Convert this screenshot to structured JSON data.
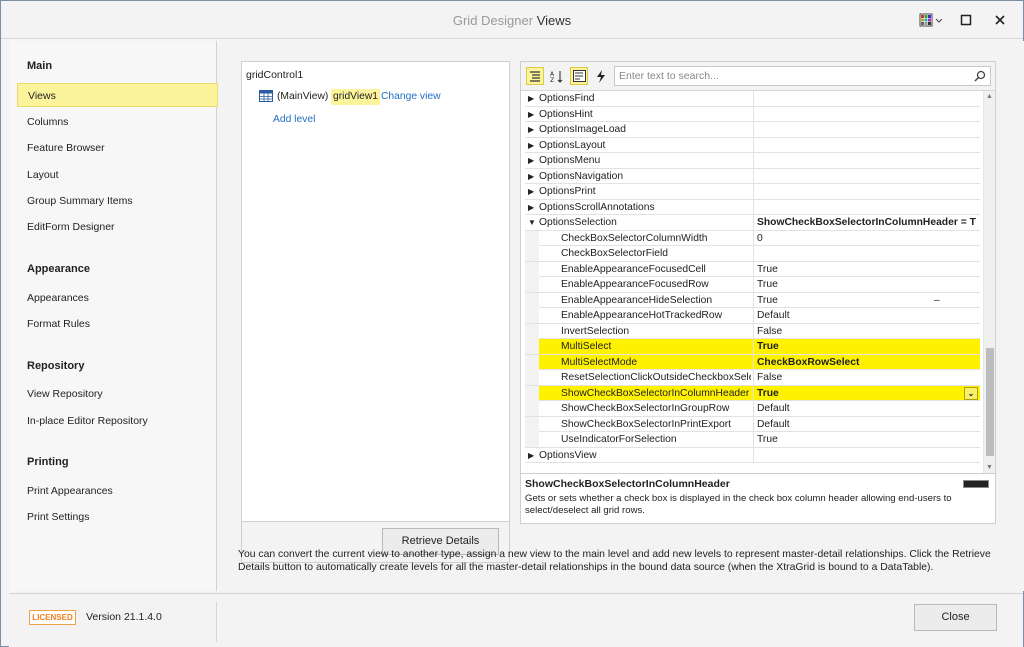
{
  "window": {
    "title_prefix": "Grid Designer",
    "title_main": "Views"
  },
  "sidebar": {
    "groups": [
      {
        "title": "Main",
        "items": [
          {
            "label": "Views",
            "active": true
          },
          {
            "label": "Columns"
          },
          {
            "label": "Feature Browser"
          },
          {
            "label": "Layout"
          },
          {
            "label": "Group Summary Items"
          },
          {
            "label": "EditForm Designer"
          }
        ]
      },
      {
        "title": "Appearance",
        "items": [
          {
            "label": "Appearances"
          },
          {
            "label": "Format Rules"
          }
        ]
      },
      {
        "title": "Repository",
        "items": [
          {
            "label": "View Repository"
          },
          {
            "label": "In-place Editor Repository"
          }
        ]
      },
      {
        "title": "Printing",
        "items": [
          {
            "label": "Print Appearances"
          },
          {
            "label": "Print Settings"
          }
        ]
      }
    ]
  },
  "tree": {
    "root": "gridControl1",
    "main_view_label": "(MainView)",
    "view_name": "gridView1",
    "change_view": "Change view",
    "add_level": "Add level",
    "retrieve_button": "Retrieve Details"
  },
  "properties": {
    "search_placeholder": "Enter text to search...",
    "rows": [
      {
        "name": "OptionsFind",
        "value": "",
        "level": 0,
        "expander": "right"
      },
      {
        "name": "OptionsHint",
        "value": "",
        "level": 0,
        "expander": "right"
      },
      {
        "name": "OptionsImageLoad",
        "value": "",
        "level": 0,
        "expander": "right"
      },
      {
        "name": "OptionsLayout",
        "value": "",
        "level": 0,
        "expander": "right"
      },
      {
        "name": "OptionsMenu",
        "value": "",
        "level": 0,
        "expander": "right"
      },
      {
        "name": "OptionsNavigation",
        "value": "",
        "level": 0,
        "expander": "right"
      },
      {
        "name": "OptionsPrint",
        "value": "",
        "level": 0,
        "expander": "right"
      },
      {
        "name": "OptionsScrollAnnotations",
        "value": "",
        "level": 0,
        "expander": "right"
      },
      {
        "name": "OptionsSelection",
        "value": "ShowCheckBoxSelectorInColumnHeader = T",
        "level": 0,
        "expander": "down",
        "bold_value": true
      },
      {
        "name": "CheckBoxSelectorColumnWidth",
        "value": "0",
        "level": 1
      },
      {
        "name": "CheckBoxSelectorField",
        "value": "",
        "level": 1
      },
      {
        "name": "EnableAppearanceFocusedCell",
        "value": "True",
        "level": 1
      },
      {
        "name": "EnableAppearanceFocusedRow",
        "value": "True",
        "level": 1
      },
      {
        "name": "EnableAppearanceHideSelection",
        "value": "True",
        "level": 1,
        "extra": "–"
      },
      {
        "name": "EnableAppearanceHotTrackedRow",
        "value": "Default",
        "level": 1
      },
      {
        "name": "InvertSelection",
        "value": "False",
        "level": 1
      },
      {
        "name": "MultiSelect",
        "value": "True",
        "level": 1,
        "highlight": true,
        "bold_value": true
      },
      {
        "name": "MultiSelectMode",
        "value": "CheckBoxRowSelect",
        "level": 1,
        "highlight": true,
        "bold_value": true
      },
      {
        "name": "ResetSelectionClickOutsideCheckboxSelect",
        "value": "False",
        "level": 1
      },
      {
        "name": "ShowCheckBoxSelectorInColumnHeader",
        "value": "True",
        "level": 1,
        "highlight": true,
        "bold_value": true,
        "combo": true
      },
      {
        "name": "ShowCheckBoxSelectorInGroupRow",
        "value": "Default",
        "level": 1
      },
      {
        "name": "ShowCheckBoxSelectorInPrintExport",
        "value": "Default",
        "level": 1
      },
      {
        "name": "UseIndicatorForSelection",
        "value": "True",
        "level": 1
      },
      {
        "name": "OptionsView",
        "value": "",
        "level": 0,
        "expander": "right"
      }
    ],
    "description_title": "ShowCheckBoxSelectorInColumnHeader",
    "description_text": "Gets or sets whether a check box is displayed in the check box column header allowing end-users to select/deselect all grid rows."
  },
  "info_text": "You can convert the current view to another type, assign a new view to the main level and add new levels to represent master-detail relationships. Click the Retrieve Details button to automatically create levels for all the master-detail relationships in the bound data source (when the XtraGrid is bound to a DataTable).",
  "footer": {
    "badge": "LICENSED",
    "version": "Version 21.1.4.0",
    "close_button": "Close"
  },
  "colors": {
    "highlight": "#fff200",
    "active_nav": "#fbf49b",
    "link": "#1f6fc5"
  }
}
